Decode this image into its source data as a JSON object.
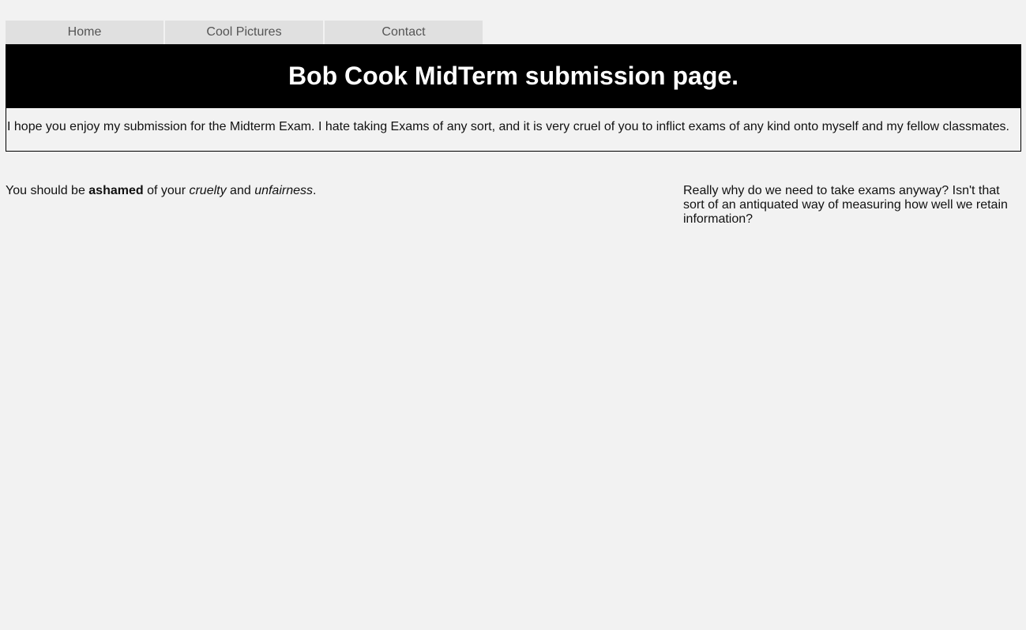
{
  "nav": {
    "items": [
      {
        "label": "Home"
      },
      {
        "label": "Cool Pictures"
      },
      {
        "label": "Contact"
      }
    ]
  },
  "banner": {
    "title": "Bob Cook MidTerm submission page."
  },
  "intro": {
    "text": "I hope you enjoy my submission for the Midterm Exam. I hate taking Exams of any sort, and it is very cruel of you to inflict exams of any kind onto myself and my fellow classmates."
  },
  "left": {
    "part1": "You should be ",
    "bold": "ashamed",
    "part2": " of your ",
    "italic1": "cruelty",
    "part3": " and ",
    "italic2": "unfairness",
    "part4": "."
  },
  "right": {
    "text": "Really why do we need to take exams anyway? Isn't that sort of an antiquated way of measuring how well we retain information?"
  },
  "colors": {
    "page_bg": "#f2f2f2",
    "nav_bg": "#e0e0e0",
    "banner_bg": "#000000",
    "banner_text": "#ffffff"
  }
}
